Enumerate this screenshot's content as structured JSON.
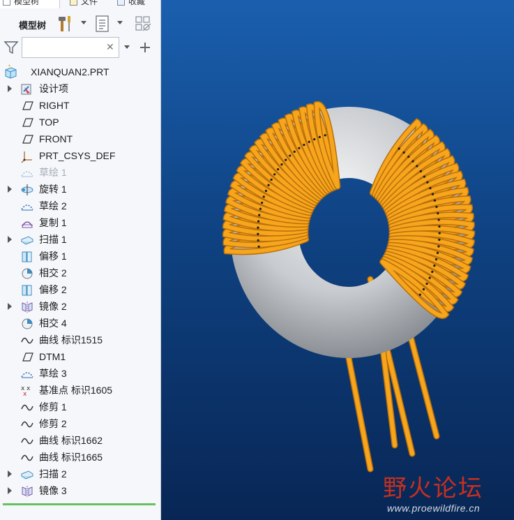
{
  "tabs": [
    {
      "label": "模型树"
    },
    {
      "label": "文件"
    },
    {
      "label": "收藏"
    }
  ],
  "toolbar": {
    "title": "模型树"
  },
  "search": {
    "value": ""
  },
  "tree": {
    "root": {
      "label": "XIANQUAN2.PRT",
      "icon": "part-icon"
    },
    "items": [
      {
        "label": "设计项",
        "icon": "design-items-icon",
        "expandable": true
      },
      {
        "label": "RIGHT",
        "icon": "datum-plane-icon"
      },
      {
        "label": "TOP",
        "icon": "datum-plane-icon"
      },
      {
        "label": "FRONT",
        "icon": "datum-plane-icon"
      },
      {
        "label": "PRT_CSYS_DEF",
        "icon": "csys-icon"
      },
      {
        "label": "草绘 1",
        "icon": "sketch-icon",
        "dim": true
      },
      {
        "label": "旋转 1",
        "icon": "revolve-icon",
        "expandable": true
      },
      {
        "label": "草绘 2",
        "icon": "sketch-icon"
      },
      {
        "label": "复制 1",
        "icon": "copy-icon"
      },
      {
        "label": "扫描 1",
        "icon": "sweep-icon",
        "expandable": true
      },
      {
        "label": "偏移 1",
        "icon": "offset-icon"
      },
      {
        "label": "相交 2",
        "icon": "intersect-icon"
      },
      {
        "label": "偏移 2",
        "icon": "offset-icon"
      },
      {
        "label": "镜像 2",
        "icon": "mirror-icon",
        "expandable": true
      },
      {
        "label": "相交 4",
        "icon": "intersect-icon"
      },
      {
        "label": "曲线 标识1515",
        "icon": "curve-icon"
      },
      {
        "label": "DTM1",
        "icon": "datum-plane-icon"
      },
      {
        "label": "草绘 3",
        "icon": "sketch-icon"
      },
      {
        "label": "基准点 标识1605",
        "icon": "datum-point-icon"
      },
      {
        "label": "修剪 1",
        "icon": "curve-icon"
      },
      {
        "label": "修剪 2",
        "icon": "curve-icon"
      },
      {
        "label": "曲线 标识1662",
        "icon": "curve-icon"
      },
      {
        "label": "曲线 标识1665",
        "icon": "curve-icon"
      },
      {
        "label": "扫描 2",
        "icon": "sweep-icon",
        "expandable": true
      },
      {
        "label": "镜像 3",
        "icon": "mirror-icon",
        "expandable": true
      }
    ]
  },
  "watermark": {
    "brand": "野火论坛",
    "url": "www.proewildfire.cn"
  },
  "colors": {
    "accent_green": "#66c060",
    "wire": "#f7a51c",
    "core": "#cfd2d5",
    "viewport_top": "#1a5fae",
    "viewport_bottom": "#082655"
  }
}
